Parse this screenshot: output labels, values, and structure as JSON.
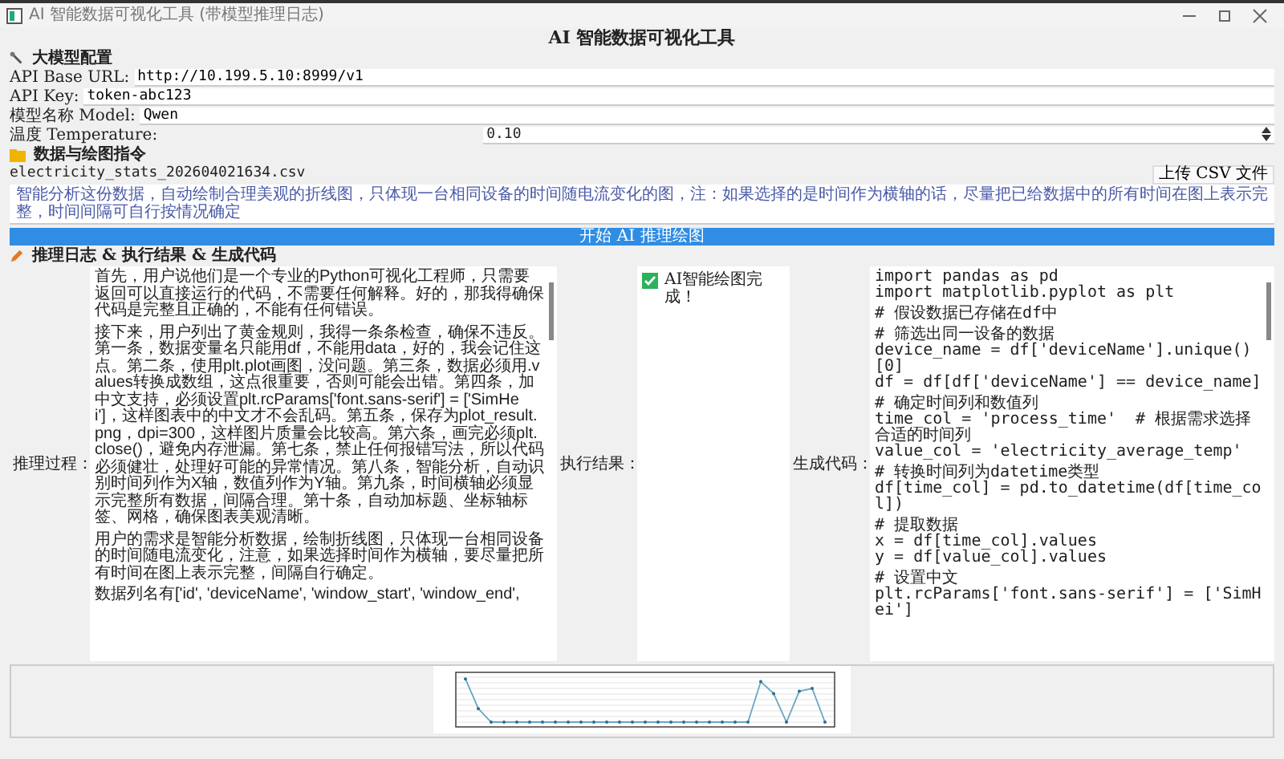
{
  "window": {
    "title": "AI 智能数据可视化工具 (带模型推理日志)"
  },
  "heading": "AI 智能数据可视化工具",
  "config": {
    "title": "大模型配置",
    "fields": [
      {
        "label": "API Base URL:",
        "value": "http://10.199.5.10:8999/v1",
        "kind": "text"
      },
      {
        "label": "API Key:",
        "value": "token-abc123",
        "kind": "text"
      },
      {
        "label": "模型名称 Model:",
        "value": "Qwen",
        "kind": "text"
      },
      {
        "label": "温度 Temperature:",
        "value": "0.10",
        "kind": "spin"
      }
    ]
  },
  "data": {
    "title": "数据与绘图指令",
    "file_name": "electricity_stats_202604021634.csv",
    "upload_button": "上传 CSV 文件",
    "prompt": "智能分析这份数据，自动绘制合理美观的折线图，只体现一台相同设备的时间随电流变化的图，注：如果选择的是时间作为横轴的话，尽量把已给数据中的所有时间在图上表示完整，时间间隔可自行按情况确定",
    "run_button": "开始 AI 推理绘图"
  },
  "results": {
    "title": "推理日志 & 执行结果 & 生成代码",
    "log_label": "推理过程：",
    "log": [
      "首先，用户说他们是一个专业的Python可视化工程师，只需要返回可以直接运行的代码，不需要任何解释。好的，那我得确保代码是完整且正确的，不能有任何错误。",
      "接下来，用户列出了黄金规则，我得一条条检查，确保不违反。第一条，数据变量名只能用df，不能用data，好的，我会记住这点。第二条，使用plt.plot画图，没问题。第三条，数据必须用.values转换成数组，这点很重要，否则可能会出错。第四条，加中文支持，必须设置plt.rcParams['font.sans-serif'] = ['SimHei']，这样图表中的中文才不会乱码。第五条，保存为plot_result.png，dpi=300，这样图片质量会比较高。第六条，画完必须plt.close()，避免内存泄漏。第七条，禁止任何报错写法，所以代码必须健壮，处理好可能的异常情况。第八条，智能分析，自动识别时间列作为X轴，数值列作为Y轴。第九条，时间横轴必须显示完整所有数据，间隔合理。第十条，自动加标题、坐标轴标签、网格，确保图表美观清晰。",
      "用户的需求是智能分析数据，绘制折线图，只体现一台相同设备的时间随电流变化，注意，如果选择时间作为横轴，要尽量把所有时间在图上表示完整，间隔自行确定。",
      "数据列名有['id', 'deviceName', 'window_start', 'window_end',"
    ],
    "result_label": "执行结果：",
    "result": {
      "text": "AI智能绘图完成！",
      "checked": true
    },
    "code_label": "生成代码：",
    "code": [
      [
        "import pandas as pd",
        "import matplotlib.pyplot as plt"
      ],
      [
        "# 假设数据已存储在df中"
      ],
      [
        "# 筛选出同一设备的数据",
        "device_name = df['deviceName'].unique()[0]",
        "df = df[df['deviceName'] == device_name]"
      ],
      [
        "# 确定时间列和数值列",
        "time_col = 'process_time'  # 根据需求选择合适的时间列",
        "value_col = 'electricity_average_temp'"
      ],
      [
        "# 转换时间列为datetime类型",
        "df[time_col] = pd.to_datetime(df[time_col])"
      ],
      [
        "# 提取数据",
        "x = df[time_col].values",
        "y = df[value_col].values"
      ],
      [
        "# 设置中文",
        "plt.rcParams['font.sans-serif'] = ['SimHei']"
      ]
    ]
  }
}
